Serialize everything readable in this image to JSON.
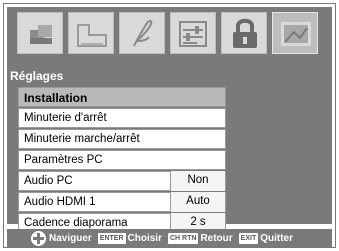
{
  "menu_title": "Réglages",
  "tabs": [
    {
      "name": "picture-icon"
    },
    {
      "name": "audio-icon"
    },
    {
      "name": "music-note-icon"
    },
    {
      "name": "settings-sliders-icon"
    },
    {
      "name": "lock-icon"
    },
    {
      "name": "photo-icon"
    }
  ],
  "items": [
    {
      "label": "Installation",
      "value": null,
      "selected": true
    },
    {
      "label": "Minuterie d'arrêt",
      "value": null
    },
    {
      "label": "Minuterie marche/arrêt",
      "value": null
    },
    {
      "label": "Paramètres PC",
      "value": null
    },
    {
      "label": "Audio PC",
      "value": "Non"
    },
    {
      "label": "Audio HDMI 1",
      "value": "Auto"
    },
    {
      "label": "Cadence diaporama",
      "value": "2 s"
    }
  ],
  "legend": {
    "navigate": "Naviguer",
    "enter_key": "ENTER",
    "choose": "Choisir",
    "return_key": "CH RTN",
    "return": "Retour",
    "exit_key": "EXIT",
    "quit": "Quitter"
  }
}
